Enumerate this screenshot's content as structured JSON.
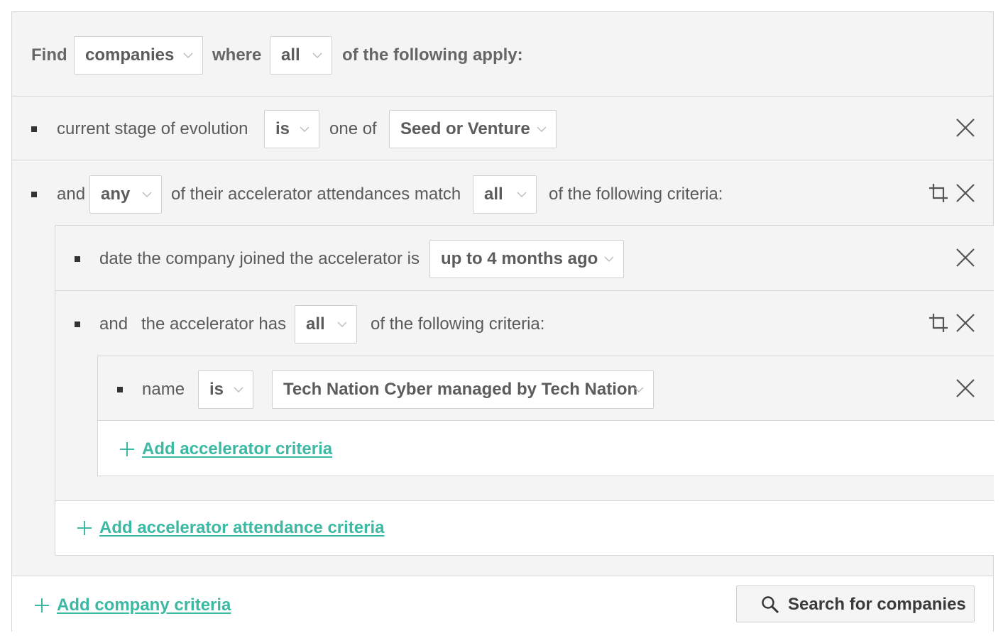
{
  "find_row": {
    "find_label": "Find",
    "entity_value": "companies",
    "where_label": "where",
    "match_value": "all",
    "suffix": "of the following apply:"
  },
  "criteria": {
    "stage": {
      "field": "current stage of evolution",
      "operator": "is",
      "connector": "one of",
      "value": "Seed or Venture"
    },
    "attendance": {
      "and_label": "and",
      "quantifier": "any",
      "middle_text": "of their accelerator attendances match",
      "match_value": "all",
      "suffix": "of the following criteria:",
      "date_criterion": {
        "field": "date the company joined the accelerator is",
        "value": "up to 4 months ago"
      },
      "accelerator": {
        "and_label": "and",
        "field": "the accelerator has",
        "match_value": "all",
        "suffix": "of the following criteria:",
        "name_criterion": {
          "field": "name",
          "operator": "is",
          "value": "Tech Nation Cyber managed by Tech Nation"
        },
        "add_label": "Add accelerator criteria"
      },
      "add_label": "Add accelerator attendance criteria"
    }
  },
  "footer": {
    "add_label": "Add company criteria",
    "search_label": "Search for companies"
  },
  "colors": {
    "accent": "#3bb9a3",
    "border": "#d6d6d6",
    "panel": "#f4f4f4"
  }
}
